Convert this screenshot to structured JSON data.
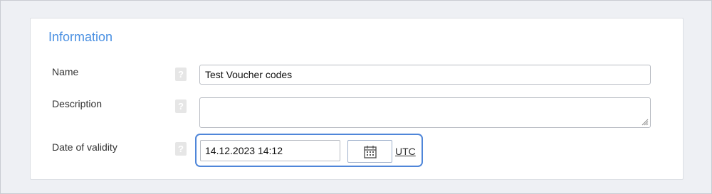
{
  "section": {
    "title": "Information"
  },
  "fields": {
    "name": {
      "label": "Name",
      "value": "Test Voucher codes",
      "help": "?"
    },
    "description": {
      "label": "Description",
      "value": "",
      "help": "?"
    },
    "validity": {
      "label": "Date of validity",
      "value": "14.12.2023 14:12",
      "help": "?",
      "timezone_link": "UTC"
    }
  },
  "icons": {
    "calendar": "calendar-icon",
    "help": "help-icon",
    "resize": "resize-grip-icon"
  },
  "colors": {
    "accent": "#4a90e2",
    "highlight_border": "#4f86d9",
    "background": "#eef0f4"
  }
}
